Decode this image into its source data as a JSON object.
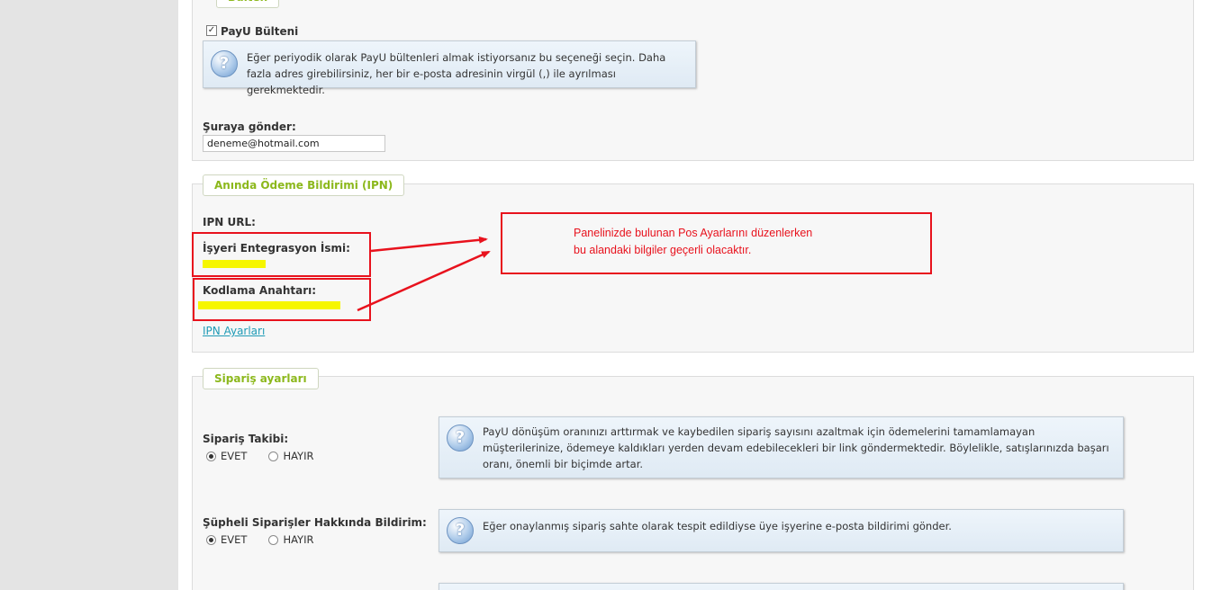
{
  "section1": {
    "legend": "Bülten",
    "newsletter_checkbox_label": "PayU Bülteni",
    "newsletter_checked": true,
    "info_text": "Eğer periyodik olarak PayU bültenleri almak istiyorsanız bu seçeneği seçin. Daha fazla adres girebilirsiniz, her bir e-posta adresinin virgül (,) ile ayrılması gerekmektedir.",
    "send_to_label": "Şuraya gönder:",
    "send_to_value": "deneme@hotmail.com"
  },
  "section2": {
    "legend": "Anında Ödeme Bildirimi (IPN)",
    "ipn_url_label": "IPN URL:",
    "merchant_name_label": "İşyeri Entegrasyon İsmi:",
    "secret_key_label": "Kodlama Anahtarı:",
    "ipn_settings_link": "IPN Ayarları"
  },
  "annotation": {
    "line1": "Panelinizde bulunan Pos Ayarlarını düzenlerken",
    "line2": "bu alandaki bilgiler geçerli olacaktır.",
    "color": "#e8121d"
  },
  "section3": {
    "legend": "Sipariş ayarları",
    "order_tracking_label": "Sipariş Takibi:",
    "order_tracking_info": "PayU dönüşüm oranınızı arttırmak ve kaybedilen sipariş sayısını azaltmak için ödemelerini tamamlamayan müşterilerinize, ödemeye kaldıkları yerden devam edebilecekleri bir link göndermektedir. Böylelikle, satışlarınızda başarı oranı, önemli bir biçimde artar.",
    "suspicious_label": "Şüpheli Siparişler Hakkında Bildirim:",
    "suspicious_info": "Eğer onaylanmış sipariş sahte olarak tespit edildiyse üye işyerine e-posta bildirimi gönder.",
    "yes_label": "EVET",
    "no_label": "HAYIR",
    "order_tracking_selected": "EVET",
    "suspicious_selected": "EVET"
  },
  "icons": {
    "help": "question-icon"
  },
  "colors": {
    "legend_green": "#8cb81c",
    "link_blue": "#1f9bb6",
    "highlight_yellow": "#f6f600"
  }
}
